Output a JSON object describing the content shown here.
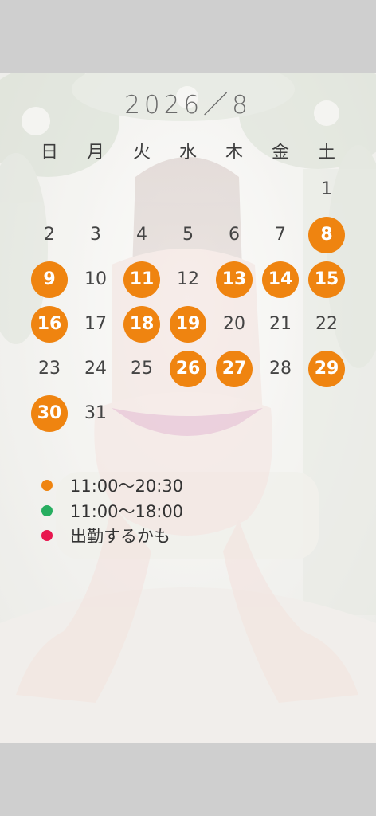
{
  "calendar": {
    "title": "2026／8",
    "weekdays": [
      "日",
      "月",
      "火",
      "水",
      "木",
      "金",
      "土"
    ],
    "weeks": [
      [
        null,
        null,
        null,
        null,
        null,
        null,
        1
      ],
      [
        2,
        3,
        4,
        5,
        6,
        7,
        8
      ],
      [
        9,
        10,
        11,
        12,
        13,
        14,
        15
      ],
      [
        16,
        17,
        18,
        19,
        20,
        21,
        22
      ],
      [
        23,
        24,
        25,
        26,
        27,
        28,
        29
      ],
      [
        30,
        31,
        null,
        null,
        null,
        null,
        null
      ]
    ],
    "highlighted_days": [
      8,
      9,
      11,
      13,
      14,
      15,
      16,
      18,
      19,
      26,
      27,
      29,
      30
    ],
    "highlight_color": "#ef8410"
  },
  "legend": {
    "items": [
      {
        "color": "#ef8410",
        "label": "11:00〜20:30"
      },
      {
        "color": "#27ae60",
        "label": "11:00〜18:00"
      },
      {
        "color": "#e8174f",
        "label": "出勤するかも"
      }
    ]
  }
}
